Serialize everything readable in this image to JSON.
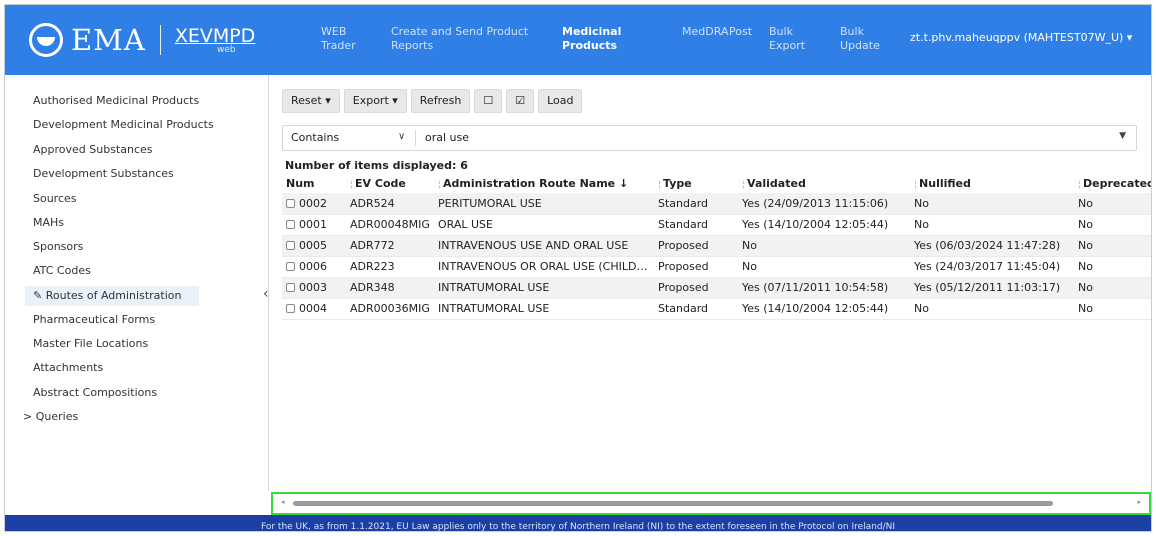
{
  "header": {
    "logo": "EMA",
    "app": "XEVMPD",
    "app_sub": "web",
    "nav": [
      {
        "label": "WEB\nTrader"
      },
      {
        "label": "Create and Send Product\nReports"
      },
      {
        "label": "Medicinal\nProducts",
        "active": true
      },
      {
        "label": "MedDRA"
      },
      {
        "label": "Post"
      },
      {
        "label": "Bulk\nExport"
      },
      {
        "label": "Bulk\nUpdate"
      }
    ],
    "user": "zt.t.phv.maheuqppv (MAHTEST07W_U) ▾"
  },
  "sidebar": {
    "items": [
      {
        "label": "Authorised Medicinal Products"
      },
      {
        "label": "Development Medicinal Products"
      },
      {
        "label": "Approved Substances"
      },
      {
        "label": "Development Substances"
      },
      {
        "label": "Sources"
      },
      {
        "label": "MAHs"
      },
      {
        "label": "Sponsors"
      },
      {
        "label": "ATC Codes"
      },
      {
        "label": "✎ Routes of Administration",
        "active": true
      },
      {
        "label": "Pharmaceutical Forms"
      },
      {
        "label": "Master File Locations"
      },
      {
        "label": "Attachments"
      },
      {
        "label": "Abstract Compositions"
      },
      {
        "label": "> Queries"
      }
    ],
    "collapse": "‹"
  },
  "toolbar": {
    "reset": "Reset ▾",
    "export": "Export ▾",
    "refresh": "Refresh",
    "uncheck": "☐",
    "check": "☑",
    "load": "Load"
  },
  "filter": {
    "operator": "Contains",
    "chevron": "∨",
    "value": "oral use",
    "dropdown": "▼"
  },
  "count_label": "Number of items displayed: 6",
  "table": {
    "columns": [
      "Num",
      "EV Code",
      "Administration Route Name ↓",
      "Type",
      "Validated",
      "Nullified",
      "Deprecated"
    ],
    "rows": [
      [
        "0002",
        "ADR524",
        "PERITUMORAL USE",
        "Standard",
        "Yes (24/09/2013 11:15:06)",
        "No",
        "No"
      ],
      [
        "0001",
        "ADR00048MIG",
        "ORAL USE",
        "Standard",
        "Yes (14/10/2004 12:05:44)",
        "No",
        "No"
      ],
      [
        "0005",
        "ADR772",
        "INTRAVENOUS USE AND ORAL USE",
        "Proposed",
        "No",
        "Yes (06/03/2024 11:47:28)",
        "No"
      ],
      [
        "0006",
        "ADR223",
        "INTRAVENOUS OR ORAL USE (CHILD…",
        "Proposed",
        "No",
        "Yes (24/03/2017 11:45:04)",
        "No"
      ],
      [
        "0003",
        "ADR348",
        "INTRATUMORAL USE",
        "Proposed",
        "Yes (07/11/2011 10:54:58)",
        "Yes (05/12/2011 11:03:17)",
        "No"
      ],
      [
        "0004",
        "ADR00036MIG",
        "INTRATUMORAL USE",
        "Standard",
        "Yes (14/10/2004 12:05:44)",
        "No",
        "No"
      ]
    ]
  },
  "scrollbar": {
    "left": "◂",
    "right": "▸"
  },
  "footer": "For the UK, as from 1.1.2021, EU Law applies only to the territory of Northern Ireland (NI) to the extent foreseen in the Protocol on Ireland/NI"
}
